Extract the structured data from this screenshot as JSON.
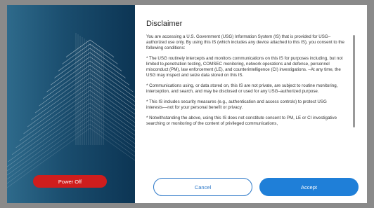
{
  "dialog": {
    "title": "Disclaimer",
    "paragraphs": [
      "You are accessing a U.S. Government (USG) Information System (IS) that is provided for USG–authorized use only. By using this IS (which includes any device attached to this IS), you consent to the following conditions:",
      "* The USG routinely intercepts and monitors communications on this IS for purposes including, but not limited to,penetration testing, COMSEC monitoring, network operations and defense, personnel misconduct (PM), law enforcement (LE), and counterintelligence (CI) investigations. –At any time, the USG may inspect and seize data stored on this IS.",
      "* Communications using, or data stored on, this IS are not private, are subject to routine monitoring, interception, and search, and may be disclosed or used for any USG–authorized purpose.",
      "* This IS includes security measures (e.g., authentication and access controls) to protect USG interests––not for your personal benefit or privacy.",
      "* Notwithstanding the above, using this IS does not constitute consent to PM, LE or CI investigative searching or monitoring of the content of privileged communications,"
    ],
    "cancel_label": "Cancel",
    "accept_label": "Accept"
  },
  "left_panel": {
    "power_off_label": "Power Off"
  },
  "colors": {
    "panel_dark": "#0c3554",
    "panel_light": "#2e6a8b",
    "power_red": "#cf1d1d",
    "accent_blue": "#1f7fd8"
  }
}
